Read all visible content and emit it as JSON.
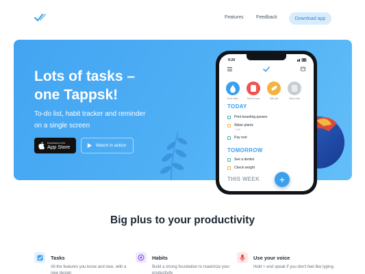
{
  "header": {
    "nav": [
      "Features",
      "Feedback"
    ],
    "download_label": "Download app"
  },
  "hero": {
    "title_line1": "Lots of tasks –",
    "title_line2": "one Tappsk!",
    "subtitle_line1": "To-do list, habit tracker and reminder",
    "subtitle_line2": "on a single screen",
    "appstore_small": "Download on the",
    "appstore_big": "App Store",
    "watch_label": "Watch in action"
  },
  "phone": {
    "time": "9:24",
    "habits": [
      {
        "label": "Drink water",
        "color": "#3aa0ee"
      },
      {
        "label": "Read a book",
        "color": "#ef5350"
      },
      {
        "label": "Take pills",
        "color": "#f4b23f"
      },
      {
        "label": "Take a bike",
        "color": "#c8cdd3"
      }
    ],
    "today_title": "TODAY",
    "today_tasks": [
      {
        "text": "Print boarding passes",
        "sub": ""
      },
      {
        "text": "Water plants",
        "sub": "+ add"
      },
      {
        "text": "Pay rent",
        "sub": ""
      }
    ],
    "tomorrow_title": "TOMORROW",
    "tomorrow_tasks": [
      {
        "text": "See a dentist"
      },
      {
        "text": "Check weight"
      }
    ],
    "this_week_title": "THIS WEEK",
    "fab": "+"
  },
  "features": {
    "heading": "Big plus to your productivity",
    "items": [
      {
        "title": "Tasks",
        "desc": "All the features you know and love, with a new design",
        "icon": "check-square-icon",
        "color": "#3aa0ee",
        "bg": "#e3f1fd"
      },
      {
        "title": "Habits",
        "desc": "Build a strong foundation to maximize your productivity",
        "icon": "target-icon",
        "color": "#8b5cf6",
        "bg": "#efe9fd"
      },
      {
        "title": "Use your voice",
        "desc": "Hold + and speak if you don't feel like typing",
        "icon": "microphone-icon",
        "color": "#ef4444",
        "bg": "#fde8e8"
      }
    ]
  },
  "colors": {
    "accent": "#3aa0ee",
    "hero_bg": "#4fb0f5"
  }
}
